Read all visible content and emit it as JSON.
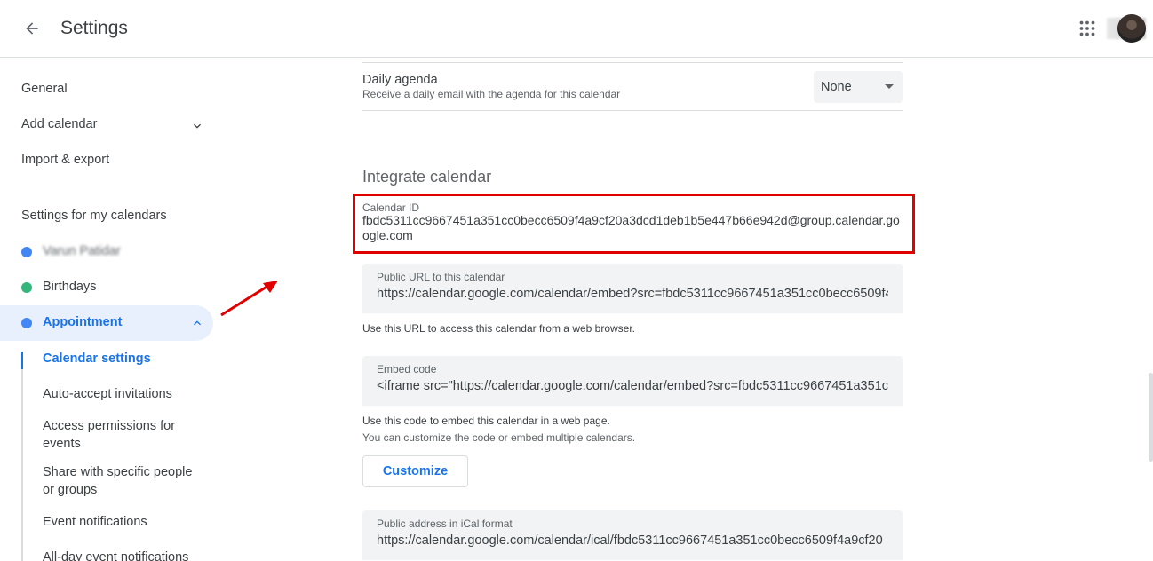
{
  "header": {
    "title": "Settings",
    "back_icon": "arrow-back-icon",
    "apps_icon": "apps-grid-icon"
  },
  "sidebar": {
    "top_items": [
      {
        "label": "General"
      },
      {
        "label": "Add calendar"
      },
      {
        "label": "Import & export"
      }
    ],
    "my_calendars_heading": "Settings for my calendars",
    "calendars": [
      {
        "label": "Varun Patidar",
        "color": "#4285f4"
      },
      {
        "label": "Birthdays",
        "color": "#33b679"
      },
      {
        "label": "Appointment",
        "color": "#4285f4"
      }
    ],
    "sub_items": [
      {
        "label": "Calendar settings"
      },
      {
        "label": "Auto-accept invitations"
      },
      {
        "label": "Access permissions for events"
      },
      {
        "label": "Share with specific people or groups"
      },
      {
        "label": "Event notifications"
      },
      {
        "label": "All-day event notifications"
      }
    ]
  },
  "daily_agenda": {
    "title": "Daily agenda",
    "description": "Receive a daily email with the agenda for this calendar",
    "selected": "None"
  },
  "integrate": {
    "title": "Integrate calendar",
    "calendar_id_label": "Calendar ID",
    "calendar_id": "fbdc5311cc9667451a351cc0becc6509f4a9cf20a3dcd1deb1b5e447b66e942d@group.calendar.google.com",
    "public_url_label": "Public URL to this calendar",
    "public_url": "https://calendar.google.com/calendar/embed?src=fbdc5311cc9667451a351cc0becc6509f4",
    "public_url_help": "Use this URL to access this calendar from a web browser.",
    "embed_label": "Embed code",
    "embed_code": "<iframe src=\"https://calendar.google.com/calendar/embed?src=fbdc5311cc9667451a351cc",
    "embed_help": "Use this code to embed this calendar in a web page.",
    "embed_help2": "You can customize the code or embed multiple calendars.",
    "customize_label": "Customize",
    "ical_label": "Public address in iCal format",
    "ical_url": "https://calendar.google.com/calendar/ical/fbdc5311cc9667451a351cc0becc6509f4a9cf20"
  },
  "colors": {
    "accent": "#1a73e8",
    "highlight_box": "#e00000",
    "annotation_arrow": "#e00000"
  }
}
